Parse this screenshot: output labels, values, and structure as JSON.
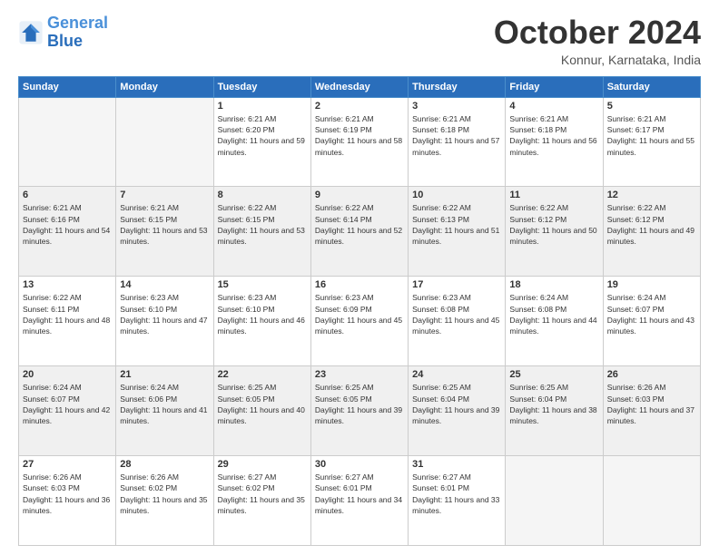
{
  "header": {
    "logo_line1": "General",
    "logo_line2": "Blue",
    "title": "October 2024",
    "location": "Konnur, Karnataka, India"
  },
  "days_of_week": [
    "Sunday",
    "Monday",
    "Tuesday",
    "Wednesday",
    "Thursday",
    "Friday",
    "Saturday"
  ],
  "weeks": [
    [
      {
        "day": "",
        "info": ""
      },
      {
        "day": "",
        "info": ""
      },
      {
        "day": "1",
        "info": "Sunrise: 6:21 AM\nSunset: 6:20 PM\nDaylight: 11 hours and 59 minutes."
      },
      {
        "day": "2",
        "info": "Sunrise: 6:21 AM\nSunset: 6:19 PM\nDaylight: 11 hours and 58 minutes."
      },
      {
        "day": "3",
        "info": "Sunrise: 6:21 AM\nSunset: 6:18 PM\nDaylight: 11 hours and 57 minutes."
      },
      {
        "day": "4",
        "info": "Sunrise: 6:21 AM\nSunset: 6:18 PM\nDaylight: 11 hours and 56 minutes."
      },
      {
        "day": "5",
        "info": "Sunrise: 6:21 AM\nSunset: 6:17 PM\nDaylight: 11 hours and 55 minutes."
      }
    ],
    [
      {
        "day": "6",
        "info": "Sunrise: 6:21 AM\nSunset: 6:16 PM\nDaylight: 11 hours and 54 minutes."
      },
      {
        "day": "7",
        "info": "Sunrise: 6:21 AM\nSunset: 6:15 PM\nDaylight: 11 hours and 53 minutes."
      },
      {
        "day": "8",
        "info": "Sunrise: 6:22 AM\nSunset: 6:15 PM\nDaylight: 11 hours and 53 minutes."
      },
      {
        "day": "9",
        "info": "Sunrise: 6:22 AM\nSunset: 6:14 PM\nDaylight: 11 hours and 52 minutes."
      },
      {
        "day": "10",
        "info": "Sunrise: 6:22 AM\nSunset: 6:13 PM\nDaylight: 11 hours and 51 minutes."
      },
      {
        "day": "11",
        "info": "Sunrise: 6:22 AM\nSunset: 6:12 PM\nDaylight: 11 hours and 50 minutes."
      },
      {
        "day": "12",
        "info": "Sunrise: 6:22 AM\nSunset: 6:12 PM\nDaylight: 11 hours and 49 minutes."
      }
    ],
    [
      {
        "day": "13",
        "info": "Sunrise: 6:22 AM\nSunset: 6:11 PM\nDaylight: 11 hours and 48 minutes."
      },
      {
        "day": "14",
        "info": "Sunrise: 6:23 AM\nSunset: 6:10 PM\nDaylight: 11 hours and 47 minutes."
      },
      {
        "day": "15",
        "info": "Sunrise: 6:23 AM\nSunset: 6:10 PM\nDaylight: 11 hours and 46 minutes."
      },
      {
        "day": "16",
        "info": "Sunrise: 6:23 AM\nSunset: 6:09 PM\nDaylight: 11 hours and 45 minutes."
      },
      {
        "day": "17",
        "info": "Sunrise: 6:23 AM\nSunset: 6:08 PM\nDaylight: 11 hours and 45 minutes."
      },
      {
        "day": "18",
        "info": "Sunrise: 6:24 AM\nSunset: 6:08 PM\nDaylight: 11 hours and 44 minutes."
      },
      {
        "day": "19",
        "info": "Sunrise: 6:24 AM\nSunset: 6:07 PM\nDaylight: 11 hours and 43 minutes."
      }
    ],
    [
      {
        "day": "20",
        "info": "Sunrise: 6:24 AM\nSunset: 6:07 PM\nDaylight: 11 hours and 42 minutes."
      },
      {
        "day": "21",
        "info": "Sunrise: 6:24 AM\nSunset: 6:06 PM\nDaylight: 11 hours and 41 minutes."
      },
      {
        "day": "22",
        "info": "Sunrise: 6:25 AM\nSunset: 6:05 PM\nDaylight: 11 hours and 40 minutes."
      },
      {
        "day": "23",
        "info": "Sunrise: 6:25 AM\nSunset: 6:05 PM\nDaylight: 11 hours and 39 minutes."
      },
      {
        "day": "24",
        "info": "Sunrise: 6:25 AM\nSunset: 6:04 PM\nDaylight: 11 hours and 39 minutes."
      },
      {
        "day": "25",
        "info": "Sunrise: 6:25 AM\nSunset: 6:04 PM\nDaylight: 11 hours and 38 minutes."
      },
      {
        "day": "26",
        "info": "Sunrise: 6:26 AM\nSunset: 6:03 PM\nDaylight: 11 hours and 37 minutes."
      }
    ],
    [
      {
        "day": "27",
        "info": "Sunrise: 6:26 AM\nSunset: 6:03 PM\nDaylight: 11 hours and 36 minutes."
      },
      {
        "day": "28",
        "info": "Sunrise: 6:26 AM\nSunset: 6:02 PM\nDaylight: 11 hours and 35 minutes."
      },
      {
        "day": "29",
        "info": "Sunrise: 6:27 AM\nSunset: 6:02 PM\nDaylight: 11 hours and 35 minutes."
      },
      {
        "day": "30",
        "info": "Sunrise: 6:27 AM\nSunset: 6:01 PM\nDaylight: 11 hours and 34 minutes."
      },
      {
        "day": "31",
        "info": "Sunrise: 6:27 AM\nSunset: 6:01 PM\nDaylight: 11 hours and 33 minutes."
      },
      {
        "day": "",
        "info": ""
      },
      {
        "day": "",
        "info": ""
      }
    ]
  ]
}
